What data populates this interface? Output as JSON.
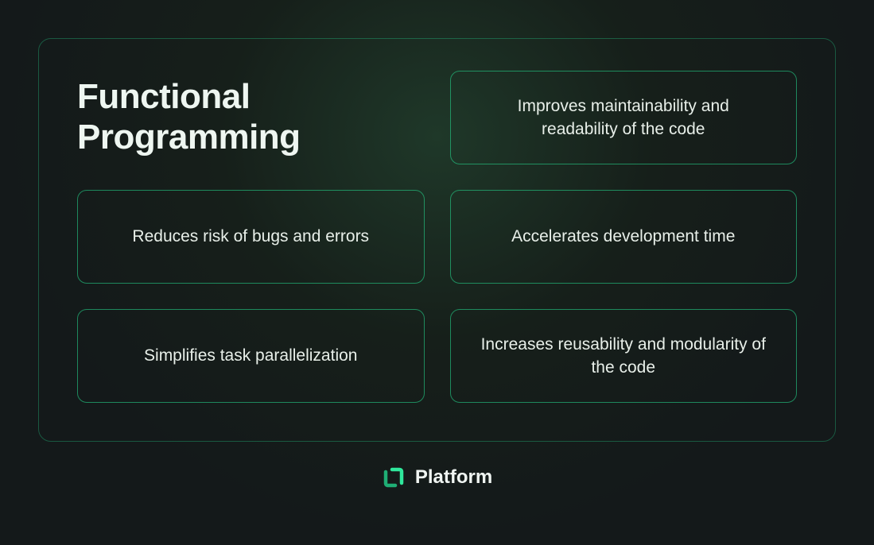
{
  "title": "Functional Programming",
  "cards": [
    "Improves maintainability and readability of the code",
    "Reduces risk of bugs and errors",
    "Accelerates development time",
    "Simplifies task parallelization",
    "Increases reusability and modularity of the code"
  ],
  "footer": {
    "brand": "Platform"
  }
}
